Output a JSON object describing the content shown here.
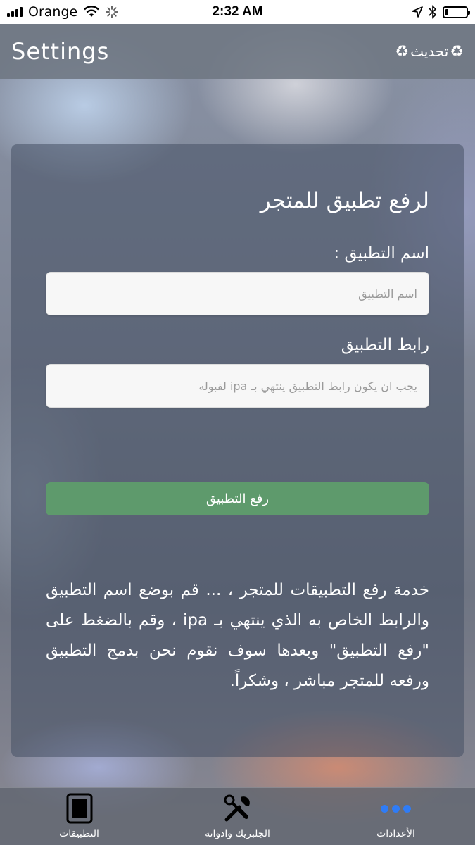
{
  "status_bar": {
    "carrier": "Orange",
    "time": "2:32 AM",
    "battery_level": 0.15
  },
  "nav": {
    "title": "Settings",
    "refresh_label": "تحديث",
    "refresh_icon": "recycle-icon"
  },
  "form": {
    "title": "لرفع تطبيق للمتجر",
    "app_name_label": "اسم التطبيق :",
    "app_name_placeholder": "اسم التطبيق",
    "app_link_label": "رابط التطبيق",
    "app_link_placeholder": "يجب ان يكون رابط التطبيق ينتهي بـ ipa لقبوله",
    "submit_label": "رفع التطبيق",
    "submit_color": "#5e9a6c",
    "description": "خدمة رفع التطبيقات للمتجر ، ... قم بوضع اسم التطبيق والرابط الخاص به الذي ينتهي بـ ipa ، وقم بالضغط على \"رفع التطبيق\" وبعدها سوف نقوم نحن بدمج التطبيق ورفعه للمتجر مباشر ، وشكراً."
  },
  "tabs": [
    {
      "label": "التطبيقات",
      "icon": "apps-icon"
    },
    {
      "label": "الجلبريك وادواته",
      "icon": "tools-icon"
    },
    {
      "label": "الأعدادات",
      "icon": "more-dots-icon",
      "accent": "#2f7cf6"
    }
  ]
}
